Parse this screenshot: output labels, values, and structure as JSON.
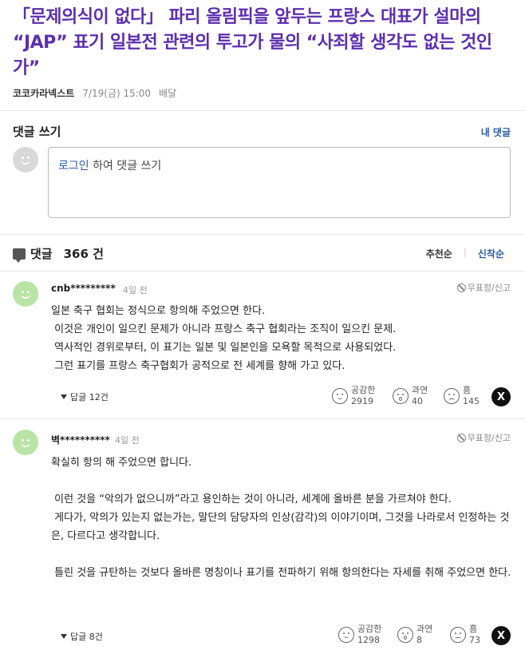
{
  "article": {
    "title": "「문제의식이 없다」 파리 올림픽을 앞두는 프랑스 대표가 설마의 “JAP” 표기 일본전 관련의 투고가 물의 “사죄할 생각도 없는 것인가”",
    "publisher": "코코카라넥스트",
    "datetime": "7/19(금) 15:00",
    "distribution": "배달"
  },
  "write": {
    "title": "댓글 쓰기",
    "my_comments": "내 댓글",
    "login_link": "로그인",
    "placeholder_rest": " 하여 댓글 쓰기"
  },
  "comments_header": {
    "label": "댓글",
    "count": "366 건",
    "sort_recommended": "추천순",
    "sort_newest": "신착순"
  },
  "comments": [
    {
      "author": "cnb*********",
      "time": "4일 전",
      "report": "무표정/신고",
      "body": "일본 축구 협회는 정식으로 항의해 주었으면 한다.\n 이것은 개인이 일으킨 문제가 아니라 프랑스 축구 협회라는 조직이 일으킨 문제.\n 역사적인 경위로부터, 이 표기는 일본 및 일본인을 모욕할 목적으로 사용되었다.\n 그런 표기를 프랑스 축구협회가 공적으로 전 세계를 향해 가고 있다.",
      "replies": "답글 12건",
      "reactions": {
        "agree_label": "공감한",
        "agree_count": "2919",
        "wow_label": "과연",
        "wow_count": "40",
        "hmm_label": "흠",
        "hmm_count": "145"
      },
      "share": "X"
    },
    {
      "author": "벽**********",
      "time": "4일 전",
      "report": "무표정/신고",
      "body": "확실히 항의 해 주었으면 합니다.\n\n 이런 것을 “악의가 없으니까”라고 용인하는 것이 아니라, 세계에 올바른 분을 가르쳐야 한다.\n 게다가, 악의가 있는지 없는가는, 말단의 담당자의 인상(감각)의 이야기이며, 그것을 나라로서 인정하는 것은, 다르다고 생각합니다.\n\n 틀린 것을 규탄하는 것보다 올바른 명칭이나 표기를 전파하기 위해 항의한다는 자세를 취해 주었으면 한다.",
      "replies": "답글 8건",
      "reactions": {
        "agree_label": "공감한",
        "agree_count": "1298",
        "wow_label": "과연",
        "wow_count": "8",
        "hmm_label": "흠",
        "hmm_count": "73"
      },
      "share": "X"
    }
  ]
}
